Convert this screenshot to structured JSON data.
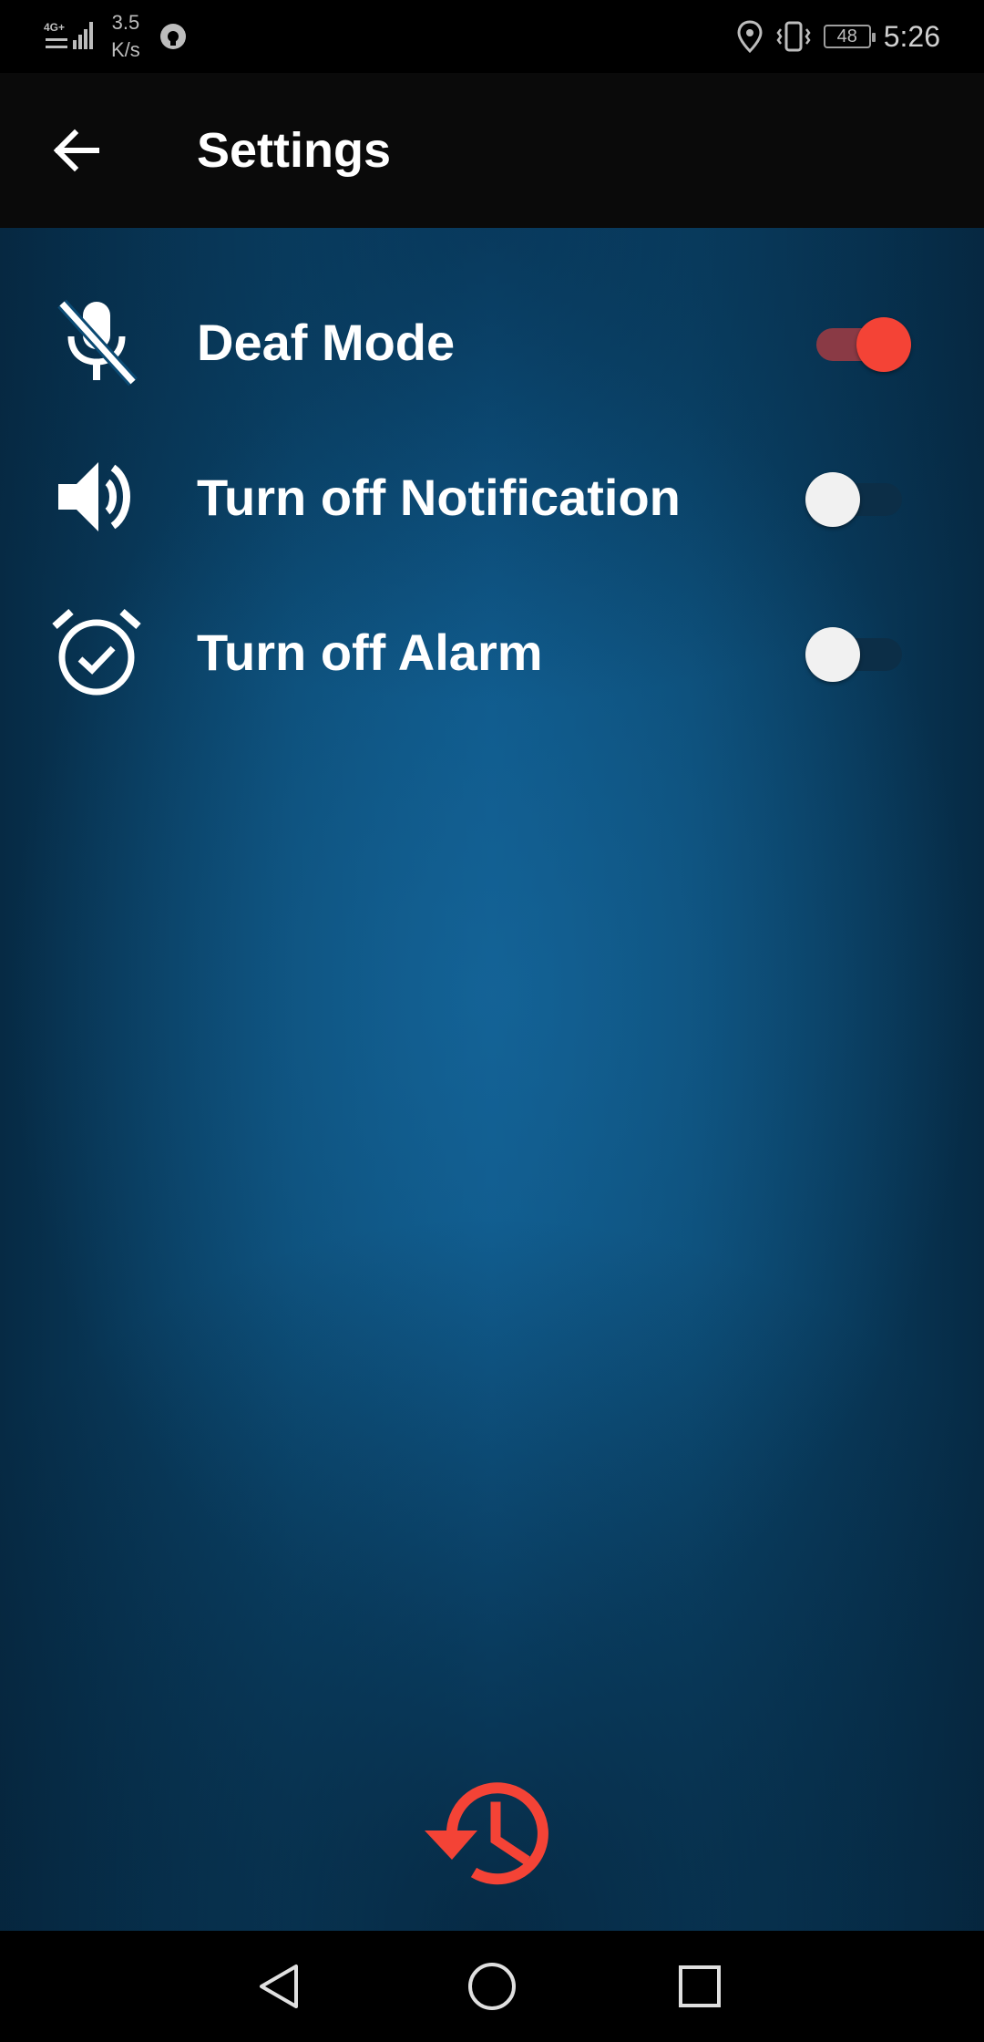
{
  "status_bar": {
    "network": "4G+",
    "speed_value": "3.5",
    "speed_unit": "K/s",
    "battery": "48",
    "time": "5:26"
  },
  "app_bar": {
    "title": "Settings",
    "back_icon": "arrow-left-icon"
  },
  "settings": [
    {
      "label": "Deaf Mode",
      "icon": "mic-off-icon",
      "enabled": true
    },
    {
      "label": "Turn off Notification",
      "icon": "volume-icon",
      "enabled": false
    },
    {
      "label": "Turn off Alarm",
      "icon": "alarm-check-icon",
      "enabled": false
    }
  ],
  "history_button": {
    "icon": "history-icon"
  },
  "nav_bar": {
    "back_icon": "nav-back-icon",
    "home_icon": "nav-home-icon",
    "recents_icon": "nav-recents-icon"
  },
  "colors": {
    "accent": "#f44336",
    "toggle_on_track": "#8a3a45",
    "toggle_off_thumb": "#f1f1f1",
    "app_bar_bg": "#0a0a0a",
    "content_bg": "#0d5585"
  }
}
